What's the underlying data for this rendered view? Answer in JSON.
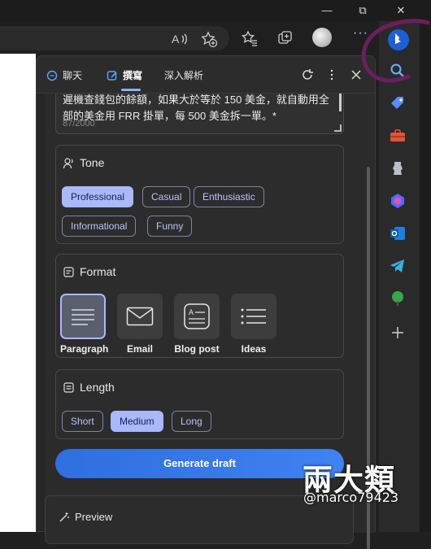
{
  "window": {
    "minimize_glyph": "—",
    "restore_glyph": "⧉",
    "close_glyph": "✕"
  },
  "toolbar": {
    "icons": [
      "read-aloud-icon",
      "add-favorite-icon",
      "favorites-icon",
      "collections-icon",
      "profile-avatar",
      "more-icon",
      "bing-copilot-icon"
    ],
    "more_label": "···"
  },
  "rail": {
    "icons": [
      "search-icon",
      "shopping-tag-icon",
      "tools-icon",
      "games-icon",
      "microsoft-365-icon",
      "outlook-icon",
      "telegram-icon",
      "tree-icon",
      "add-icon"
    ]
  },
  "sidebar": {
    "tabs": [
      {
        "label": "聊天",
        "icon": "chat-icon"
      },
      {
        "label": "撰寫",
        "icon": "compose-icon",
        "active": true
      },
      {
        "label": "深入解析",
        "icon": ""
      }
    ],
    "compose": {
      "text": "遲機查錢包的餘額，如果大於等於 150 美金，就自動用全部的美金用 FRR 掛單，每 500 美金拆一單。*",
      "char_count": "87/2000",
      "tone": {
        "title": "Tone",
        "options": [
          "Professional",
          "Casual",
          "Enthusiastic",
          "Informational",
          "Funny"
        ],
        "selected": "Professional"
      },
      "format": {
        "title": "Format",
        "options": [
          "Paragraph",
          "Email",
          "Blog post",
          "Ideas"
        ],
        "selected": "Paragraph"
      },
      "length": {
        "title": "Length",
        "options": [
          "Short",
          "Medium",
          "Long"
        ],
        "selected": "Medium"
      },
      "generate_label": "Generate draft",
      "preview_label": "Preview"
    }
  },
  "watermark": {
    "name": "兩大類",
    "handle": "@marco79423"
  },
  "colors": {
    "accent": "#a9b8ff",
    "button": "#3478ea",
    "annotation": "#6a1f5f"
  }
}
